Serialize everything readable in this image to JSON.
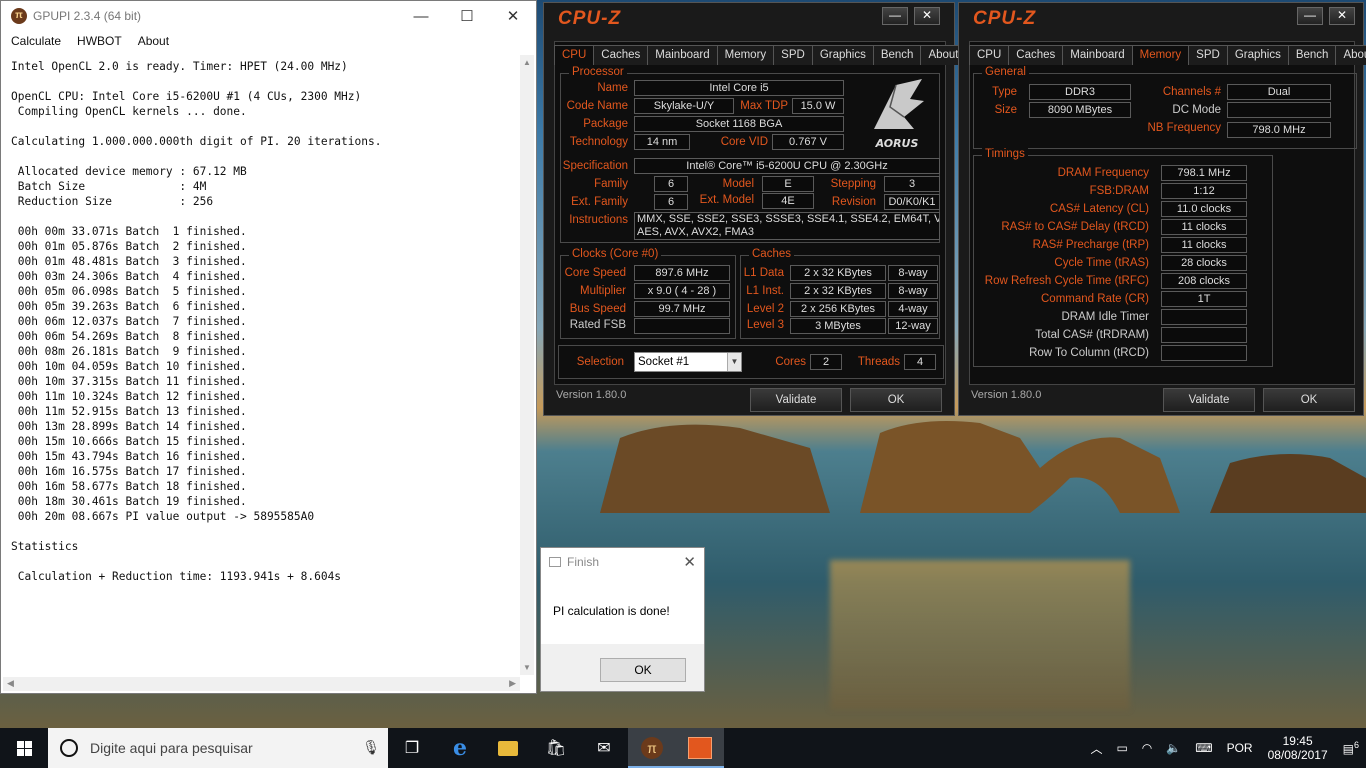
{
  "gpupi": {
    "title": "GPUPI 2.3.4 (64 bit)",
    "menu": [
      "Calculate",
      "HWBOT",
      "About"
    ],
    "console_lines": [
      "Intel OpenCL 2.0 is ready. Timer: HPET (24.00 MHz)",
      "",
      "OpenCL CPU: Intel Core i5-6200U #1 (4 CUs, 2300 MHz)",
      " Compiling OpenCL kernels ... done.",
      "",
      "Calculating 1.000.000.000th digit of PI. 20 iterations.",
      "",
      " Allocated device memory : 67.12 MB",
      " Batch Size              : 4M",
      " Reduction Size          : 256",
      "",
      " 00h 00m 33.071s Batch  1 finished.",
      " 00h 01m 05.876s Batch  2 finished.",
      " 00h 01m 48.481s Batch  3 finished.",
      " 00h 03m 24.306s Batch  4 finished.",
      " 00h 05m 06.098s Batch  5 finished.",
      " 00h 05m 39.263s Batch  6 finished.",
      " 00h 06m 12.037s Batch  7 finished.",
      " 00h 06m 54.269s Batch  8 finished.",
      " 00h 08m 26.181s Batch  9 finished.",
      " 00h 10m 04.059s Batch 10 finished.",
      " 00h 10m 37.315s Batch 11 finished.",
      " 00h 11m 10.324s Batch 12 finished.",
      " 00h 11m 52.915s Batch 13 finished.",
      " 00h 13m 28.899s Batch 14 finished.",
      " 00h 15m 10.666s Batch 15 finished.",
      " 00h 15m 43.794s Batch 16 finished.",
      " 00h 16m 16.575s Batch 17 finished.",
      " 00h 16m 58.677s Batch 18 finished.",
      " 00h 18m 30.461s Batch 19 finished.",
      " 00h 20m 08.667s PI value output -> 5895585A0",
      "",
      "Statistics",
      "",
      " Calculation + Reduction time: 1193.941s + 8.604s"
    ]
  },
  "cpuz_cpu": {
    "logo": "CPU-Z",
    "tabs": [
      "CPU",
      "Caches",
      "Mainboard",
      "Memory",
      "SPD",
      "Graphics",
      "Bench",
      "About"
    ],
    "processor_title": "Processor",
    "name_label": "Name",
    "name": "Intel Core i5",
    "codename_label": "Code Name",
    "codename": "Skylake-U/Y",
    "maxtdp_label": "Max TDP",
    "maxtdp": "15.0 W",
    "package_label": "Package",
    "package": "Socket 1168 BGA",
    "technology_label": "Technology",
    "technology": "14 nm",
    "corevid_label": "Core VID",
    "corevid": "0.767 V",
    "brand": "AORUS",
    "spec_label": "Specification",
    "spec": "Intel® Core™ i5-6200U CPU @ 2.30GHz",
    "family_label": "Family",
    "family": "6",
    "model_label": "Model",
    "model": "E",
    "stepping_label": "Stepping",
    "stepping": "3",
    "extfamily_label": "Ext. Family",
    "extfamily": "6",
    "extmodel_label": "Ext. Model",
    "extmodel": "4E",
    "revision_label": "Revision",
    "revision": "D0/K0/K1",
    "instructions_label": "Instructions",
    "instructions_1": "MMX, SSE, SSE2, SSE3, SSSE3, SSE4.1, SSE4.2, EM64T, VT-x,",
    "instructions_2": "AES, AVX, AVX2, FMA3",
    "clocks_title": "Clocks (Core #0)",
    "corespeed_label": "Core Speed",
    "corespeed": "897.6 MHz",
    "multiplier_label": "Multiplier",
    "multiplier": "x 9.0 ( 4 - 28 )",
    "busspeed_label": "Bus Speed",
    "busspeed": "99.7 MHz",
    "ratedfsb_label": "Rated FSB",
    "ratedfsb": "",
    "caches_title": "Caches",
    "l1data_label": "L1 Data",
    "l1data": "2 x 32 KBytes",
    "l1data_way": "8-way",
    "l1inst_label": "L1 Inst.",
    "l1inst": "2 x 32 KBytes",
    "l1inst_way": "8-way",
    "l2_label": "Level 2",
    "l2": "2 x 256 KBytes",
    "l2_way": "4-way",
    "l3_label": "Level 3",
    "l3": "3 MBytes",
    "l3_way": "12-way",
    "selection_label": "Selection",
    "selection": "Socket #1",
    "cores_label": "Cores",
    "cores": "2",
    "threads_label": "Threads",
    "threads": "4",
    "version": "Version 1.80.0",
    "validate": "Validate",
    "ok": "OK"
  },
  "cpuz_mem": {
    "logo": "CPU-Z",
    "tabs": [
      "CPU",
      "Caches",
      "Mainboard",
      "Memory",
      "SPD",
      "Graphics",
      "Bench",
      "About"
    ],
    "general_title": "General",
    "type_label": "Type",
    "type": "DDR3",
    "size_label": "Size",
    "size": "8090 MBytes",
    "channels_label": "Channels #",
    "channels": "Dual",
    "dcmode_label": "DC Mode",
    "dcmode": "",
    "nbfreq_label": "NB Frequency",
    "nbfreq": "798.0 MHz",
    "timings_title": "Timings",
    "timings": [
      {
        "label": "DRAM Frequency",
        "value": "798.1 MHz",
        "plain": false
      },
      {
        "label": "FSB:DRAM",
        "value": "1:12",
        "plain": false
      },
      {
        "label": "CAS# Latency (CL)",
        "value": "11.0 clocks",
        "plain": false
      },
      {
        "label": "RAS# to CAS# Delay (tRCD)",
        "value": "11 clocks",
        "plain": false
      },
      {
        "label": "RAS# Precharge (tRP)",
        "value": "11 clocks",
        "plain": false
      },
      {
        "label": "Cycle Time (tRAS)",
        "value": "28 clocks",
        "plain": false
      },
      {
        "label": "Row Refresh Cycle Time (tRFC)",
        "value": "208 clocks",
        "plain": false
      },
      {
        "label": "Command Rate (CR)",
        "value": "1T",
        "plain": false
      },
      {
        "label": "DRAM Idle Timer",
        "value": "",
        "plain": true
      },
      {
        "label": "Total CAS# (tRDRAM)",
        "value": "",
        "plain": true
      },
      {
        "label": "Row To Column (tRCD)",
        "value": "",
        "plain": true
      }
    ],
    "version": "Version 1.80.0",
    "validate": "Validate",
    "ok": "OK"
  },
  "finish": {
    "title": "Finish",
    "message": "PI calculation is done!",
    "ok": "OK"
  },
  "taskbar": {
    "search_placeholder": "Digite aqui para pesquisar",
    "lang": "POR",
    "time": "19:45",
    "date": "08/08/2017",
    "notifications": "6"
  }
}
